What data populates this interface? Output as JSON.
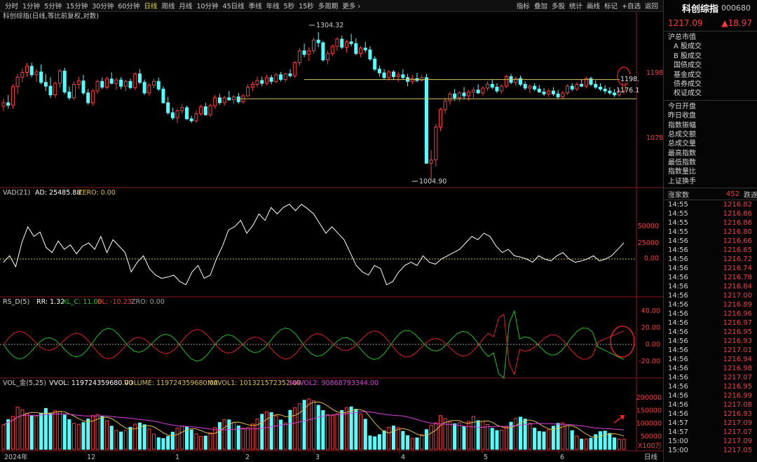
{
  "toolbar": {
    "periods": [
      "分时",
      "1分钟",
      "5分钟",
      "15分钟",
      "30分钟",
      "60分钟",
      "日线",
      "周线",
      "月线",
      "10分钟",
      "45日线",
      "季线",
      "年线",
      "5秒",
      "15秒",
      "多周期",
      "更多 ›"
    ],
    "active_index": 6,
    "tools": [
      "指标",
      "叠加",
      "多股",
      "统计",
      "画线",
      "标记",
      "+自选",
      "返回"
    ]
  },
  "main_chart": {
    "title": "科创综指(日线,等比前复权,对数)",
    "high_label": "1304.32",
    "low_label": "1004.90",
    "right_axis": [
      "1198",
      "1078"
    ],
    "price_tags": [
      "1198.",
      "1176.1"
    ],
    "candles": [
      [
        1145,
        1160,
        1135,
        1152
      ],
      [
        1152,
        1168,
        1140,
        1147
      ],
      [
        1147,
        1190,
        1140,
        1185
      ],
      [
        1185,
        1212,
        1170,
        1205
      ],
      [
        1205,
        1224,
        1195,
        1215
      ],
      [
        1215,
        1235,
        1206,
        1228
      ],
      [
        1228,
        1236,
        1205,
        1210
      ],
      [
        1210,
        1222,
        1195,
        1216
      ],
      [
        1216,
        1232,
        1190,
        1194
      ],
      [
        1194,
        1212,
        1176,
        1186
      ],
      [
        1186,
        1205,
        1162,
        1168
      ],
      [
        1168,
        1196,
        1162,
        1192
      ],
      [
        1192,
        1222,
        1182,
        1218
      ],
      [
        1218,
        1225,
        1170,
        1174
      ],
      [
        1174,
        1185,
        1158,
        1162
      ],
      [
        1162,
        1196,
        1158,
        1190
      ],
      [
        1190,
        1206,
        1180,
        1197
      ],
      [
        1197,
        1210,
        1168,
        1172
      ],
      [
        1172,
        1180,
        1148,
        1152
      ],
      [
        1152,
        1180,
        1146,
        1176
      ],
      [
        1176,
        1200,
        1170,
        1196
      ],
      [
        1196,
        1204,
        1180,
        1184
      ],
      [
        1184,
        1206,
        1180,
        1201
      ],
      [
        1201,
        1215,
        1190,
        1192
      ],
      [
        1192,
        1204,
        1178,
        1199
      ],
      [
        1199,
        1205,
        1180,
        1186
      ],
      [
        1186,
        1200,
        1176,
        1196
      ],
      [
        1196,
        1202,
        1180,
        1183
      ],
      [
        1183,
        1215,
        1178,
        1212
      ],
      [
        1212,
        1222,
        1190,
        1194
      ],
      [
        1194,
        1200,
        1168,
        1172
      ],
      [
        1172,
        1192,
        1166,
        1188
      ],
      [
        1188,
        1202,
        1182,
        1196
      ],
      [
        1196,
        1204,
        1176,
        1180
      ],
      [
        1180,
        1186,
        1150,
        1152
      ],
      [
        1152,
        1164,
        1128,
        1132
      ],
      [
        1132,
        1142,
        1118,
        1122
      ],
      [
        1122,
        1140,
        1112,
        1136
      ],
      [
        1136,
        1150,
        1130,
        1142
      ],
      [
        1142,
        1146,
        1118,
        1120
      ],
      [
        1120,
        1126,
        1112,
        1116
      ],
      [
        1116,
        1136,
        1112,
        1130
      ],
      [
        1130,
        1148,
        1126,
        1144
      ],
      [
        1144,
        1152,
        1126,
        1128
      ],
      [
        1128,
        1150,
        1124,
        1146
      ],
      [
        1146,
        1168,
        1140,
        1162
      ],
      [
        1162,
        1170,
        1148,
        1152
      ],
      [
        1152,
        1166,
        1146,
        1162
      ],
      [
        1162,
        1176,
        1156,
        1158
      ],
      [
        1158,
        1168,
        1150,
        1164
      ],
      [
        1164,
        1172,
        1150,
        1154
      ],
      [
        1154,
        1170,
        1150,
        1166
      ],
      [
        1166,
        1190,
        1164,
        1184
      ],
      [
        1184,
        1196,
        1176,
        1190
      ],
      [
        1190,
        1206,
        1184,
        1198
      ],
      [
        1198,
        1206,
        1186,
        1192
      ],
      [
        1192,
        1210,
        1188,
        1204
      ],
      [
        1204,
        1210,
        1190,
        1196
      ],
      [
        1196,
        1214,
        1192,
        1210
      ],
      [
        1210,
        1216,
        1196,
        1200
      ],
      [
        1200,
        1214,
        1194,
        1212
      ],
      [
        1212,
        1222,
        1204,
        1208
      ],
      [
        1208,
        1240,
        1204,
        1236
      ],
      [
        1236,
        1268,
        1230,
        1262
      ],
      [
        1262,
        1278,
        1248,
        1254
      ],
      [
        1254,
        1270,
        1240,
        1262
      ],
      [
        1262,
        1292,
        1256,
        1286
      ],
      [
        1286,
        1304,
        1270,
        1280
      ],
      [
        1280,
        1284,
        1238,
        1242
      ],
      [
        1242,
        1262,
        1232,
        1256
      ],
      [
        1256,
        1276,
        1250,
        1272
      ],
      [
        1272,
        1292,
        1262,
        1288
      ],
      [
        1288,
        1296,
        1266,
        1270
      ],
      [
        1270,
        1286,
        1258,
        1282
      ],
      [
        1282,
        1300,
        1272,
        1278
      ],
      [
        1278,
        1290,
        1252,
        1256
      ],
      [
        1256,
        1272,
        1248,
        1268
      ],
      [
        1268,
        1282,
        1258,
        1264
      ],
      [
        1264,
        1272,
        1240,
        1244
      ],
      [
        1244,
        1250,
        1218,
        1222
      ],
      [
        1222,
        1230,
        1206,
        1214
      ],
      [
        1214,
        1222,
        1200,
        1204
      ],
      [
        1204,
        1220,
        1198,
        1216
      ],
      [
        1216,
        1220,
        1200,
        1206
      ],
      [
        1206,
        1216,
        1196,
        1210
      ],
      [
        1210,
        1222,
        1200,
        1204
      ],
      [
        1204,
        1212,
        1186,
        1196
      ],
      [
        1196,
        1210,
        1190,
        1202
      ],
      [
        1202,
        1214,
        1194,
        1198
      ],
      [
        1198,
        1210,
        1196,
        1204
      ],
      [
        1204,
        1212,
        1164,
        1036
      ],
      [
        1036,
        1060,
        1004,
        1042
      ],
      [
        1042,
        1110,
        1030,
        1104
      ],
      [
        1104,
        1142,
        1096,
        1138
      ],
      [
        1138,
        1162,
        1130,
        1156
      ],
      [
        1156,
        1174,
        1148,
        1170
      ],
      [
        1170,
        1180,
        1156,
        1162
      ],
      [
        1162,
        1176,
        1154,
        1172
      ],
      [
        1172,
        1184,
        1160,
        1166
      ],
      [
        1166,
        1178,
        1156,
        1174
      ],
      [
        1174,
        1184,
        1162,
        1178
      ],
      [
        1178,
        1190,
        1170,
        1172
      ],
      [
        1172,
        1186,
        1166,
        1182
      ],
      [
        1182,
        1196,
        1176,
        1190
      ],
      [
        1190,
        1200,
        1180,
        1184
      ],
      [
        1184,
        1192,
        1172,
        1176
      ],
      [
        1176,
        1190,
        1170,
        1186
      ],
      [
        1186,
        1210,
        1182,
        1206
      ],
      [
        1206,
        1212,
        1190,
        1194
      ],
      [
        1194,
        1206,
        1186,
        1202
      ],
      [
        1202,
        1208,
        1186,
        1190
      ],
      [
        1190,
        1196,
        1178,
        1182
      ],
      [
        1182,
        1190,
        1172,
        1186
      ],
      [
        1186,
        1192,
        1176,
        1180
      ],
      [
        1180,
        1188,
        1172,
        1174
      ],
      [
        1174,
        1182,
        1166,
        1170
      ],
      [
        1170,
        1180,
        1164,
        1176
      ],
      [
        1176,
        1184,
        1166,
        1170
      ],
      [
        1170,
        1178,
        1160,
        1164
      ],
      [
        1164,
        1176,
        1160,
        1172
      ],
      [
        1172,
        1190,
        1168,
        1186
      ],
      [
        1186,
        1192,
        1176,
        1180
      ],
      [
        1180,
        1194,
        1176,
        1190
      ],
      [
        1190,
        1200,
        1184,
        1186
      ],
      [
        1186,
        1206,
        1182,
        1202
      ],
      [
        1202,
        1206,
        1186,
        1190
      ],
      [
        1190,
        1198,
        1180,
        1184
      ],
      [
        1184,
        1192,
        1176,
        1180
      ],
      [
        1180,
        1188,
        1170,
        1176
      ],
      [
        1176,
        1184,
        1168,
        1172
      ],
      [
        1172,
        1180,
        1164,
        1168
      ],
      [
        1168,
        1180,
        1164,
        1176
      ],
      [
        1176,
        1212,
        1170,
        1207
      ]
    ],
    "upper_line": 1200,
    "lower_line": 1160,
    "ylim_log": [
      1000,
      1320
    ]
  },
  "vad": {
    "title": "VAD(21)",
    "ad_label": "AD: 25485.88",
    "zero_label": "ZERO: 0.00",
    "axis": [
      "50000",
      "25000",
      "0.00"
    ]
  },
  "rsd": {
    "title": "RS_D(5)",
    "rr": "RR: 1.32",
    "xl": "XL_C: 11.00",
    "bl": "BL: -10.23",
    "zro": "ZRO: 0.00",
    "axis": [
      "40.00",
      "20.00",
      "0.00",
      "-20.00"
    ]
  },
  "vol": {
    "title": "VOL_金(5,25)",
    "vvol": "VVOL: 119724359680.00",
    "volume": "VOLUME: 119724359680.00",
    "mavol1": "MAVOL1: 101321572352.00",
    "mavol2": "MAVOL2: 90868793344.00",
    "axis": [
      "200000",
      "150000",
      "100000",
      "50000"
    ],
    "unit": "X100万"
  },
  "xaxis": {
    "labels": [
      "2024年",
      "12",
      "1",
      "2",
      "3",
      "4",
      "5",
      "6"
    ],
    "right": "日线"
  },
  "colors": {
    "up": "#ff3c3c",
    "down": "#54ffff",
    "line": "#ffffff",
    "ma1": "#e0c040",
    "ma2": "#e040e0",
    "guide": "#d8c860",
    "circle": "#ff2020"
  },
  "sidebar": {
    "name": "科创综指",
    "code": "000680",
    "price": "1217.09",
    "change": "▲18.97",
    "menu1": [
      "沪总市值",
      "A 股成交",
      "B 股成交",
      "国债成交",
      "基金成交",
      "债券成交",
      "权证成交"
    ],
    "menu2": [
      "今日开盘",
      "昨日收盘",
      "指数振幅",
      "总成交额",
      "总成交量",
      "最高指数",
      "最低指数",
      "指数量比",
      "上证换手"
    ],
    "breadth_label": "涨家数",
    "breadth_up": "452",
    "breadth_down_label": "跌逐",
    "ticks": [
      [
        "14:55",
        "1216.82"
      ],
      [
        "14:55",
        "1216.86"
      ],
      [
        "14:55",
        "1216.86"
      ],
      [
        "14:55",
        "1216.80"
      ],
      [
        "14:56",
        "1216.66"
      ],
      [
        "14:56",
        "1216.65"
      ],
      [
        "14:56",
        "1216.72"
      ],
      [
        "14:56",
        "1216.74"
      ],
      [
        "14:56",
        "1216.78"
      ],
      [
        "14:56",
        "1216.84"
      ],
      [
        "14:56",
        "1217.00"
      ],
      [
        "14:56",
        "1216.89"
      ],
      [
        "14:56",
        "1216.96"
      ],
      [
        "14:56",
        "1216.97"
      ],
      [
        "14:56",
        "1216.95"
      ],
      [
        "14:56",
        "1216.93"
      ],
      [
        "14:56",
        "1217.01"
      ],
      [
        "14:56",
        "1216.94"
      ],
      [
        "14:56",
        "1216.98"
      ],
      [
        "14:56",
        "1217.07"
      ],
      [
        "14:56",
        "1216.95"
      ],
      [
        "14:56",
        "1216.99"
      ],
      [
        "14:56",
        "1217.08"
      ],
      [
        "14:56",
        "1216.93"
      ],
      [
        "14:57",
        "1217.09"
      ],
      [
        "14:57",
        "1217.07"
      ],
      [
        "15:00",
        "1217.09"
      ],
      [
        "15:00",
        "1217.05"
      ]
    ]
  }
}
